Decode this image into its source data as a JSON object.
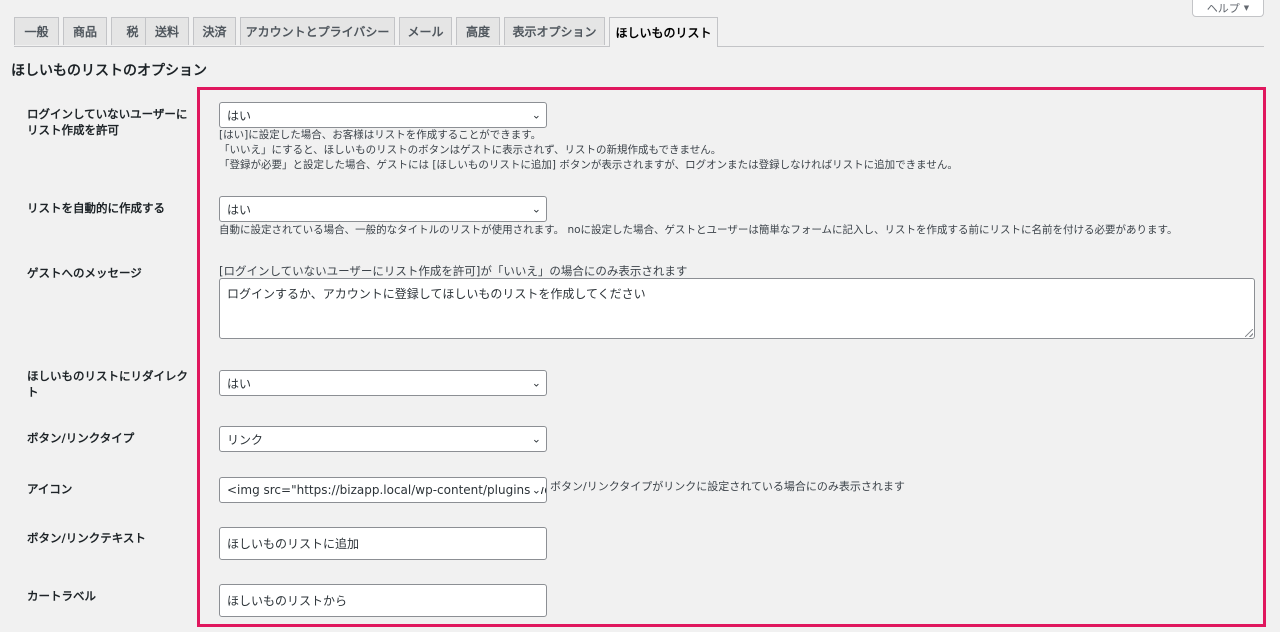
{
  "help": {
    "label": "ヘルプ",
    "icon": "caret-down-icon"
  },
  "tabs": [
    {
      "label": "一般",
      "active": false
    },
    {
      "label": "商品",
      "active": false
    },
    {
      "label": "税",
      "active": false
    },
    {
      "label": "送料",
      "active": false
    },
    {
      "label": "決済",
      "active": false
    },
    {
      "label": "アカウントとプライバシー",
      "active": false
    },
    {
      "label": "メール",
      "active": false
    },
    {
      "label": "高度",
      "active": false
    },
    {
      "label": "表示オプション",
      "active": false
    },
    {
      "label": "ほしいものリスト",
      "active": true
    }
  ],
  "heading": "ほしいものリストのオプション",
  "highlight_color": "#e0175e",
  "fields": {
    "allow_guest": {
      "label": "ログインしていないユーザーにリスト作成を許可",
      "value": "はい",
      "desc": [
        "[はい]に設定した場合、お客様はリストを作成することができます。",
        "「いいえ」にすると、ほしいものリストのボタンはゲストに表示されず、リストの新規作成もできません。",
        "「登録が必要」と設定した場合、ゲストには [ほしいものリストに追加] ボタンが表示されますが、ログオンまたは登録しなければリストに追加できません。"
      ]
    },
    "auto_create": {
      "label": "リストを自動的に作成する",
      "value": "はい",
      "desc": "自動に設定されている場合、一般的なタイトルのリストが使用されます。 noに設定した場合、ゲストとユーザーは簡単なフォームに記入し、リストを作成する前にリストに名前を付ける必要があります。"
    },
    "guest_message": {
      "label": "ゲストへのメッセージ",
      "note": "[ログインしていないユーザーにリスト作成を許可]が「いいえ」の場合にのみ表示されます",
      "value": "ログインするか、アカウントに登録してほしいものリストを作成してください"
    },
    "redirect": {
      "label": "ほしいものリストにリダイレクト",
      "value": "はい"
    },
    "button_type": {
      "label": "ボタン/リンクタイプ",
      "value": "リンク"
    },
    "icon": {
      "label": "アイコン",
      "value": "<img src=\"https://bizapp.local/wp-content/plugins/woocommerce",
      "note": "ボタン/リンクタイプがリンクに設定されている場合にのみ表示されます"
    },
    "button_text": {
      "label": "ボタン/リンクテキスト",
      "value": "ほしいものリストに追加"
    },
    "cart_label": {
      "label": "カートラベル",
      "value": "ほしいものリストから"
    }
  }
}
